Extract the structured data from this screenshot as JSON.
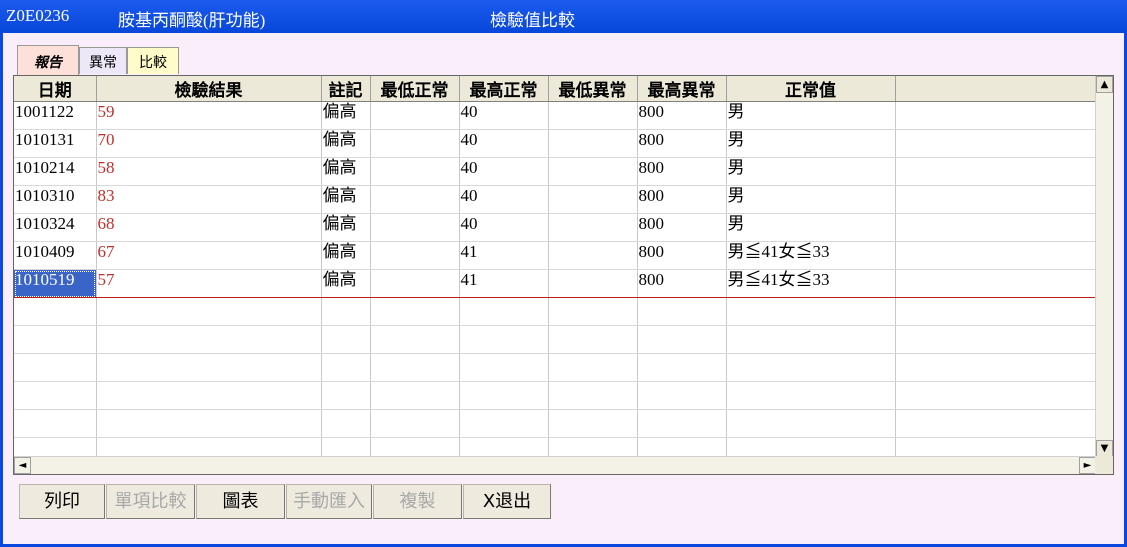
{
  "window": {
    "code": "Z0E0236",
    "item": "胺基丙酮酸(肝功能)",
    "title": "檢驗值比較"
  },
  "tabs": [
    {
      "label": "報告",
      "active": true
    },
    {
      "label": "異常",
      "active": false
    },
    {
      "label": "比較",
      "active": false
    }
  ],
  "grid": {
    "columns": [
      "日期",
      "檢驗結果",
      "註記",
      "最低正常",
      "最高正常",
      "最低異常",
      "最高異常",
      "正常值",
      ""
    ],
    "rows": [
      [
        "1001122",
        "59",
        "偏高",
        "",
        "40",
        "",
        "800",
        "男",
        ""
      ],
      [
        "1010131",
        "70",
        "偏高",
        "",
        "40",
        "",
        "800",
        "男",
        ""
      ],
      [
        "1010214",
        "58",
        "偏高",
        "",
        "40",
        "",
        "800",
        "男",
        ""
      ],
      [
        "1010310",
        "83",
        "偏高",
        "",
        "40",
        "",
        "800",
        "男",
        ""
      ],
      [
        "1010324",
        "68",
        "偏高",
        "",
        "40",
        "",
        "800",
        "男",
        ""
      ],
      [
        "1010409",
        "67",
        "偏高",
        "",
        "41",
        "",
        "800",
        "男≦41女≦33",
        ""
      ],
      [
        "1010519",
        "57",
        "偏高",
        "",
        "41",
        "",
        "800",
        "男≦41女≦33",
        ""
      ]
    ],
    "empty_rows": 6,
    "selected_row": 6
  },
  "scroll": {
    "up": "▲",
    "down": "▼",
    "left": "◄",
    "right": "►"
  },
  "buttons": [
    {
      "label": "列印",
      "enabled": true
    },
    {
      "label": "單項比較",
      "enabled": false
    },
    {
      "label": "圖表",
      "enabled": true
    },
    {
      "label": "手動匯入",
      "enabled": false
    },
    {
      "label": "複製",
      "enabled": false
    },
    {
      "label": "X退出",
      "enabled": true
    }
  ],
  "colors": {
    "result_text": "#c0302a",
    "selection": "#3a64c8",
    "title_bar": "#0646d8"
  }
}
